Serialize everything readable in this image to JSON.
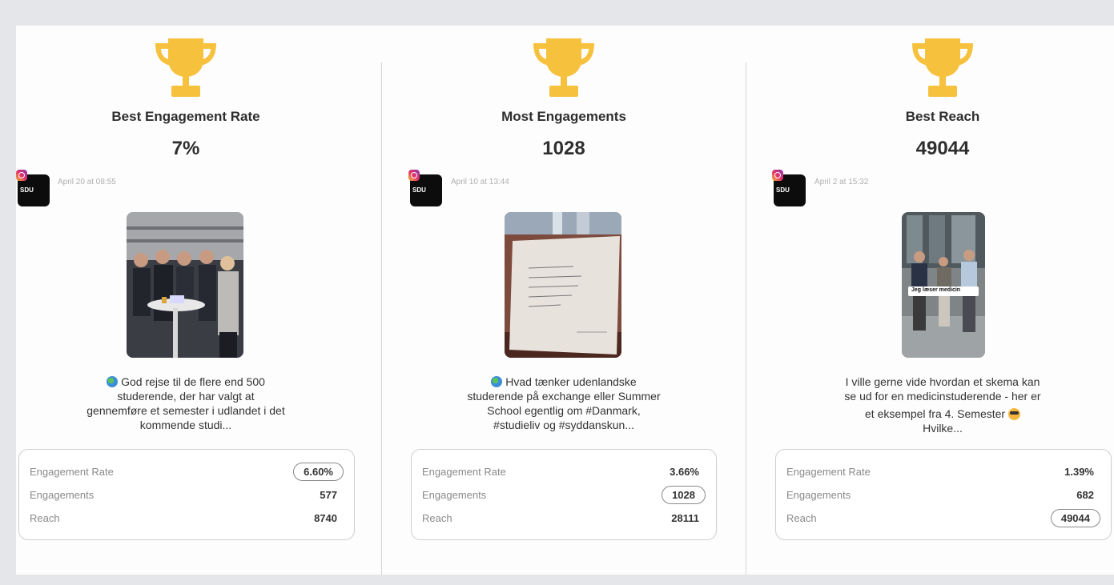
{
  "cards": [
    {
      "award_title": "Best Engagement Rate",
      "award_value": "7%",
      "account_label": "SDU",
      "date": "April 20 at 08:55",
      "caption_line1": "God rejse til de flere end 500",
      "caption_line2": "studerende, der har valgt at",
      "caption_line3": "gennemføre et semester i udlandet i det",
      "caption_line4": "kommende studi...",
      "stats": [
        {
          "label": "Engagement Rate",
          "value": "6.60%",
          "highlighted": true
        },
        {
          "label": "Engagements",
          "value": "577",
          "highlighted": false
        },
        {
          "label": "Reach",
          "value": "8740",
          "highlighted": false
        }
      ]
    },
    {
      "award_title": "Most Engagements",
      "award_value": "1028",
      "account_label": "SDU",
      "date": "April 10 at 13:44",
      "caption_line1": "Hvad tænker udenlandske",
      "caption_line2": "studerende på exchange eller Summer",
      "caption_line3": "School egentlig om #Danmark,",
      "caption_line4": "#studieliv og #syddanskun...",
      "stats": [
        {
          "label": "Engagement Rate",
          "value": "3.66%",
          "highlighted": false
        },
        {
          "label": "Engagements",
          "value": "1028",
          "highlighted": true
        },
        {
          "label": "Reach",
          "value": "28111",
          "highlighted": false
        }
      ]
    },
    {
      "award_title": "Best Reach",
      "award_value": "49044",
      "account_label": "SDU",
      "date": "April 2 at 15:32",
      "photo_overlay_text": "Jeg læser medicin",
      "caption_line1": "I ville gerne vide hvordan et skema kan",
      "caption_line2": "se ud for en medicinstuderende - her er",
      "caption_line3": "et eksempel fra 4. Semester",
      "caption_line4": "Hvilke...",
      "stats": [
        {
          "label": "Engagement Rate",
          "value": "1.39%",
          "highlighted": false
        },
        {
          "label": "Engagements",
          "value": "682",
          "highlighted": false
        },
        {
          "label": "Reach",
          "value": "49044",
          "highlighted": true
        }
      ]
    }
  ],
  "colors": {
    "trophy": "#f6c13d",
    "background": "#e4e6e9",
    "panel": "#fdfdfd",
    "highlight_border": "#8a8a8a"
  },
  "icons": [
    "trophy-icon",
    "instagram-icon",
    "globe-emoji-icon",
    "sunglasses-emoji-icon"
  ]
}
